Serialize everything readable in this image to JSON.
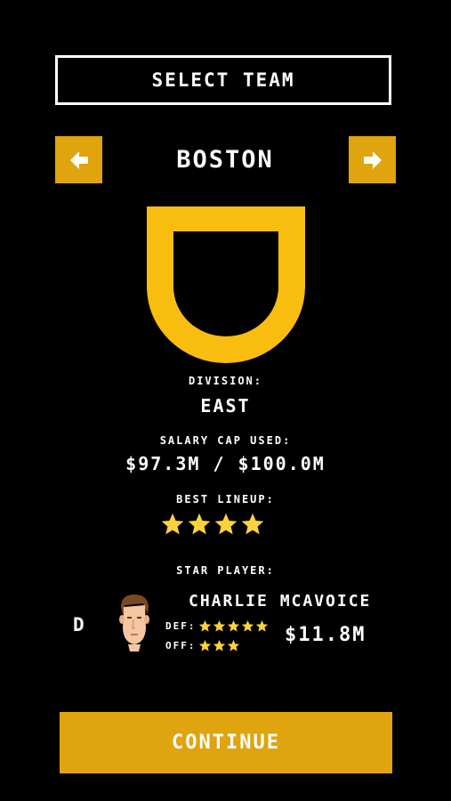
{
  "header": {
    "title": "SELECT TEAM"
  },
  "team": {
    "name": "BOSTON",
    "prev_icon": "arrow-left-icon",
    "next_icon": "arrow-right-icon",
    "logo": "shield-logo",
    "logo_color": "#F9BD0F"
  },
  "info": {
    "division_label": "DIVISION:",
    "division_value": "EAST",
    "salary_label": "SALARY CAP USED:",
    "salary_value": "$97.3M / $100.0M",
    "lineup_label": "BEST LINEUP:",
    "lineup_stars": 4
  },
  "star_player": {
    "label": "STAR PLAYER:",
    "position": "D",
    "name": "CHARLIE MCAVOICE",
    "def_label": "DEF:",
    "def_stars": 5,
    "off_label": "OFF:",
    "off_stars": 3,
    "salary": "$11.8M"
  },
  "continue_label": "CONTINUE",
  "colors": {
    "accent": "#DFA40E",
    "star": "#FFD23A",
    "background": "#000000"
  }
}
